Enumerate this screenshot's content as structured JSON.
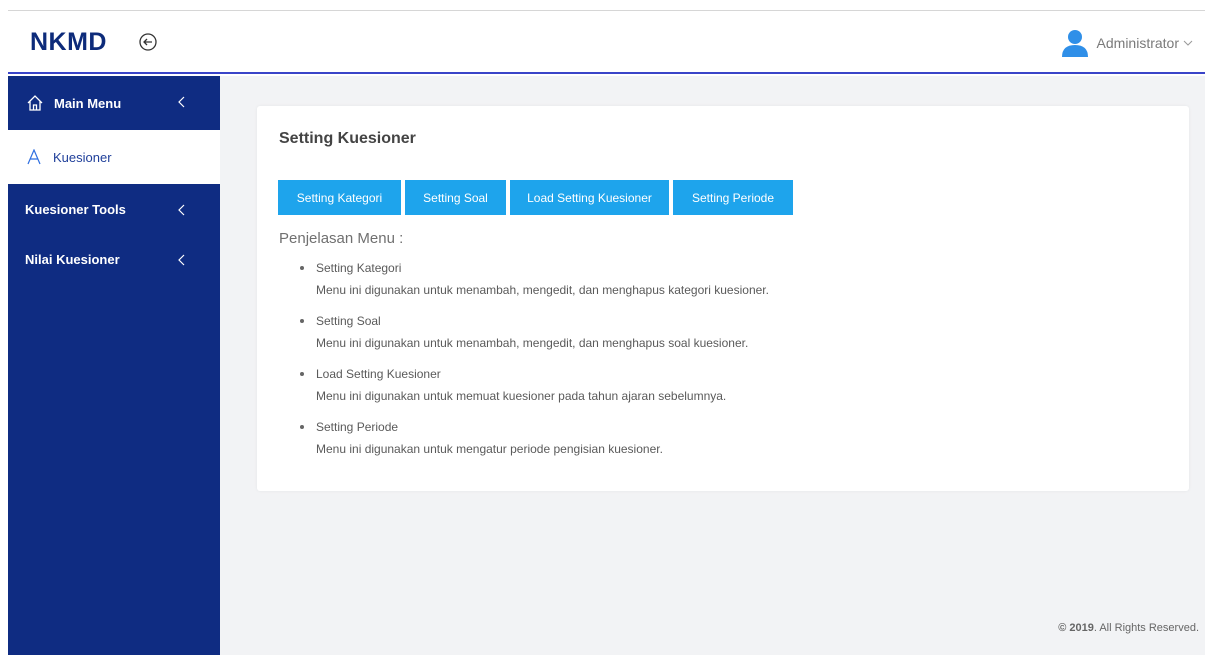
{
  "header": {
    "brand": "NKMD",
    "user_name": "Administrator"
  },
  "sidebar": {
    "items": [
      {
        "label": "Main Menu",
        "icon": "home-icon"
      },
      {
        "label": "Kuesioner",
        "icon": "font-a-icon",
        "active": true
      },
      {
        "label": "Kuesioner Tools"
      },
      {
        "label": "Nilai Kuesioner"
      }
    ]
  },
  "main": {
    "card_title": "Setting Kuesioner",
    "buttons": [
      "Setting Kategori",
      "Setting Soal",
      "Load Setting Kuesioner",
      "Setting Periode"
    ],
    "explain_title": "Penjelasan Menu :",
    "explanations": [
      {
        "name": "Setting Kategori",
        "desc": "Menu ini digunakan untuk menambah, mengedit, dan menghapus kategori kuesioner."
      },
      {
        "name": "Setting Soal",
        "desc": "Menu ini digunakan untuk menambah, mengedit, dan menghapus soal kuesioner."
      },
      {
        "name": "Load Setting Kuesioner",
        "desc": "Menu ini digunakan untuk memuat kuesioner pada tahun ajaran sebelumnya."
      },
      {
        "name": "Setting Periode",
        "desc": "Menu ini digunakan untuk mengatur periode pengisian kuesioner."
      }
    ]
  },
  "footer": {
    "year": "© 2019",
    "rest": ". All Rights Reserved."
  },
  "colors": {
    "sidebar_bg": "#0f2c82",
    "button_bg": "#1ea4ec",
    "header_accent": "#3a44c8"
  }
}
